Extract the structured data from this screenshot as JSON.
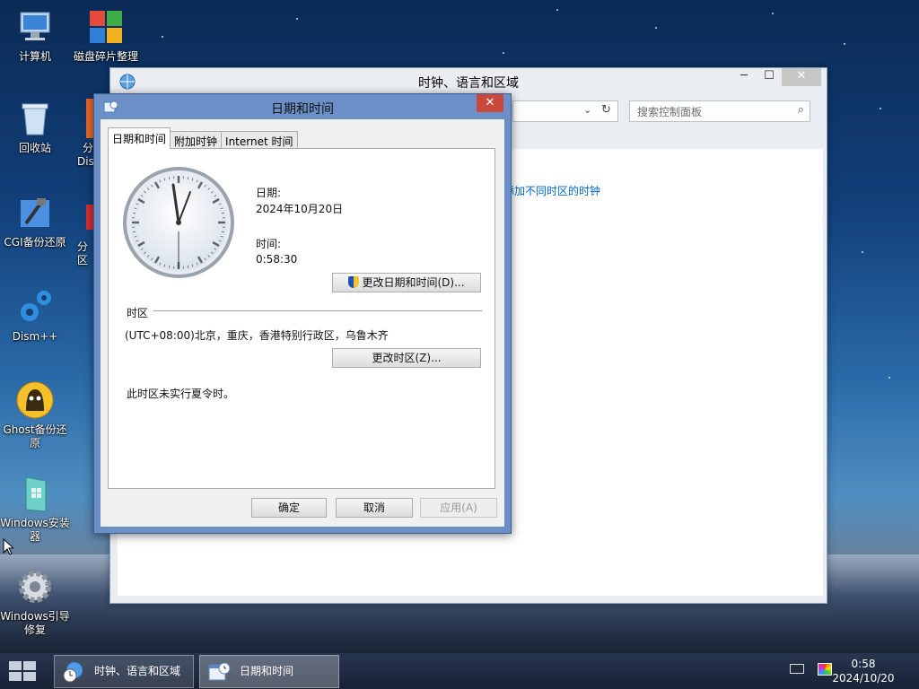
{
  "desktop": {
    "icons": [
      {
        "label": "计算机",
        "icon": "computer-icon"
      },
      {
        "label": "磁盘碎片整理",
        "icon": "defrag-icon"
      },
      {
        "label": "回收站",
        "icon": "recycle-bin-icon"
      },
      {
        "label": "分",
        "icon": "partition-icon"
      },
      {
        "label": "Dis",
        "icon": "partition-icon"
      },
      {
        "label": "CGI备份还原",
        "icon": "cgi-backup-icon"
      },
      {
        "label": "分区",
        "icon": "partition-tool-icon"
      },
      {
        "label": "Dism++",
        "icon": "gears-icon"
      },
      {
        "label": "Ghost备份还原",
        "icon": "ghost-icon"
      },
      {
        "label": "Windows安装器",
        "icon": "windows-installer-icon"
      },
      {
        "label": "Windows引导修复",
        "icon": "gear-icon"
      }
    ]
  },
  "control_panel": {
    "title": "时钟、语言和区域",
    "search_placeholder": "搜索控制面板",
    "link_text": "添加不同时区的时钟",
    "caption_minimize": "─",
    "caption_maximize": "☐",
    "caption_close": "✕"
  },
  "dialog": {
    "title": "日期和时间",
    "close": "✕",
    "tabs": [
      "日期和时间",
      "附加时钟",
      "Internet 时间"
    ],
    "date_label": "日期:",
    "date_value": "2024年10月20日",
    "time_label": "时间:",
    "time_value": "0:58:30",
    "change_datetime_button": "更改日期和时间(D)...",
    "timezone_label": "时区",
    "timezone_value": "(UTC+08:00)北京，重庆，香港特别行政区，乌鲁木齐",
    "change_timezone_button": "更改时区(Z)...",
    "dst_note": "此时区未实行夏令时。",
    "ok_button": "确定",
    "cancel_button": "取消",
    "apply_button": "应用(A)"
  },
  "taskbar": {
    "tasks": [
      {
        "label": "时钟、语言和区域",
        "active": false
      },
      {
        "label": "日期和时间",
        "active": true
      }
    ],
    "time": "0:58",
    "date": "2024/10/20"
  }
}
